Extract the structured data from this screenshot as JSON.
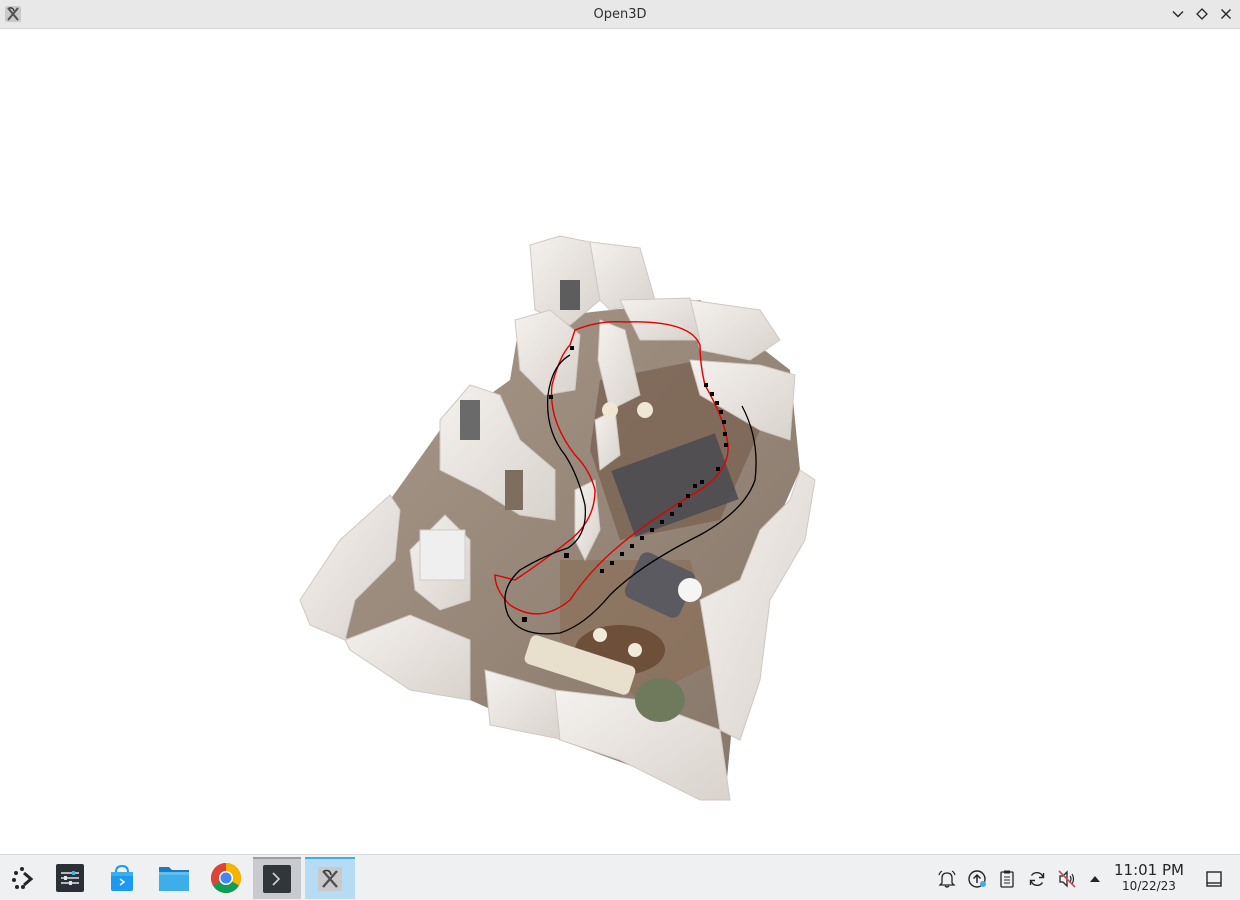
{
  "window": {
    "title": "Open3D",
    "app_icon": "open3d-x-icon",
    "buttons": [
      "minimize-chevron-icon",
      "maximize-diamond-icon",
      "close-x-icon"
    ]
  },
  "viewport": {
    "scene": "3D point cloud of apartment floor plan with camera trajectories",
    "trajectory_colors": {
      "estimated": "#e00000",
      "ground_truth": "#000000",
      "keyframes": "#000000"
    }
  },
  "taskbar": {
    "launchers": [
      {
        "name": "application-launcher-icon"
      },
      {
        "name": "system-settings-icon"
      },
      {
        "name": "discover-store-icon"
      },
      {
        "name": "file-manager-icon"
      },
      {
        "name": "chrome-browser-icon"
      },
      {
        "name": "terminal-icon"
      },
      {
        "name": "open3d-task-icon"
      }
    ],
    "tray": [
      "notifications-bell-icon",
      "updates-icon",
      "clipboard-icon",
      "sync-icon",
      "volume-muted-icon",
      "expand-tray-arrow-icon"
    ],
    "clock": {
      "time": "11:01 PM",
      "date": "10/22/23"
    },
    "show_desktop": "show-desktop-icon"
  },
  "colors": {
    "taskbar_bg": "#eff0f1",
    "titlebar_bg": "#e8e8e8",
    "active_accent": "#3daee9"
  }
}
